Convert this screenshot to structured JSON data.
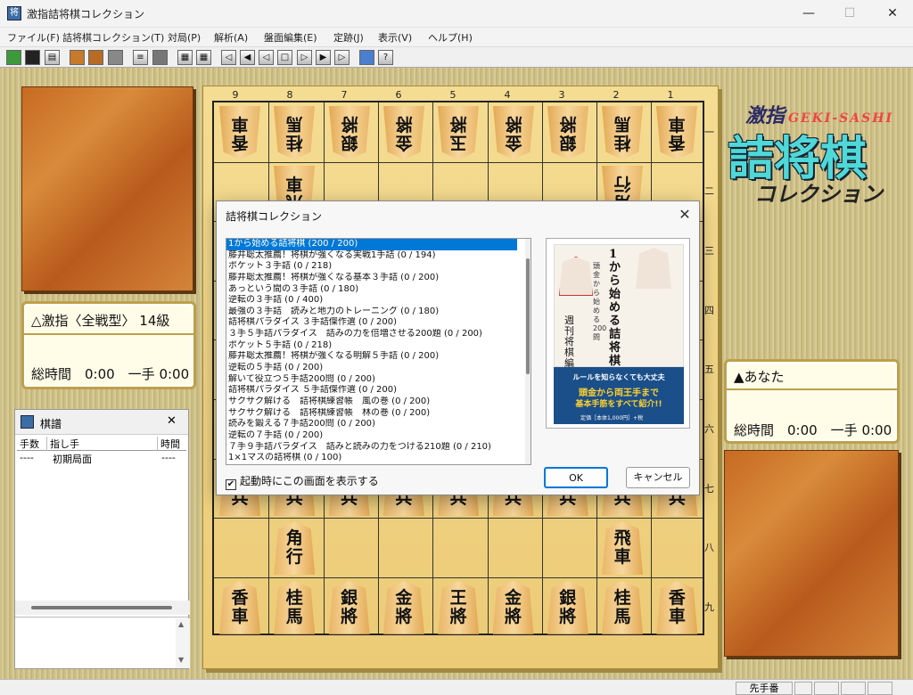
{
  "window": {
    "title": "激指詰将棋コレクション",
    "min": "—",
    "max": "☐",
    "close": "✕",
    "icon": "shogi-app-icon"
  },
  "menu": [
    "ファイル(F)",
    "詰将棋コレクション(T)",
    "対局(P)",
    "解析(A)",
    "盤面編集(E)",
    "定跡(J)",
    "表示(V)",
    "ヘルプ(H)"
  ],
  "toolbar": {
    "icons": [
      "open-icon",
      "save-icon",
      "print-icon",
      "book-icon",
      "book2-icon",
      "blank-icon",
      "list-icon",
      "disk-icon",
      "board-icon",
      "board2-icon",
      "first-icon",
      "back2-icon",
      "back-icon",
      "stop-icon",
      "forward-icon",
      "forward2-icon",
      "last-icon",
      "monitor-icon",
      "help-icon"
    ]
  },
  "board": {
    "files": [
      "9",
      "8",
      "7",
      "6",
      "5",
      "4",
      "3",
      "2",
      "1"
    ],
    "ranks": [
      "一",
      "二",
      "三",
      "四",
      "五",
      "六",
      "七",
      "八",
      "九"
    ]
  },
  "players": {
    "gote": {
      "name": "△激指〈全戦型〉 14級",
      "time": "総時間　0:00　一手 0:00"
    },
    "sente": {
      "name": "▲あなた",
      "time": "総時間　0:00　一手 0:00"
    }
  },
  "logo": {
    "top": "激指",
    "top_roman": "GEKI-SASHI",
    "main": "詰将棋",
    "sub": "コレクション"
  },
  "kifu": {
    "title": "棋譜",
    "close": "✕",
    "headers": [
      "手数",
      "指し手",
      "時間"
    ],
    "rows": [
      [
        "----",
        "初期局面",
        "----"
      ]
    ]
  },
  "dialog": {
    "title": "詰将棋コレクション",
    "close": "✕",
    "items": [
      "1から始める詰将棋 (200 / 200)",
      "藤井聡太推薦！将棋が強くなる実戦1手詰 (0 / 194)",
      "ポケット３手詰 (0 / 218)",
      "藤井聡太推薦！将棋が強くなる基本３手詰 (0 / 200)",
      "あっという間の３手詰 (0 / 180)",
      "逆転の３手詰 (0 / 400)",
      "最強の３手詰　読みと地力のトレーニング (0 / 180)",
      "詰将棋パラダイス ３手詰傑作選 (0 / 200)",
      "３手５手詰パラダイス　詰みの力を倍増させる200題 (0 / 200)",
      "ポケット５手詰 (0 / 218)",
      "藤井聡太推薦！将棋が強くなる明解５手詰 (0 / 200)",
      "逆転の５手詰 (0 / 200)",
      "解いて役立つ５手詰200問 (0 / 200)",
      "詰将棋パラダイス ５手詰傑作選 (0 / 200)",
      "サクサク解ける　詰将棋練習帳　風の巻 (0 / 200)",
      "サクサク解ける　詰将棋練習帳　林の巻 (0 / 200)",
      "読みを鍛える７手詰200問 (0 / 200)",
      "逆転の７手詰 (0 / 200)",
      "７手９手詰パラダイス　詰みと読みの力をつける210題 (0 / 210)",
      "1×1マスの詰将棋 (0 / 100)"
    ],
    "selected_index": 0,
    "cover": {
      "title": "1から始める詰将棋",
      "sub": "頭金から始める200問",
      "publisher": "週刊将棋 編",
      "band1": "ルールを知らなくても大丈夫",
      "band2": "頭金から両王手まで",
      "band3": "基本手筋をすべて紹介!!",
      "price": "定価［本体1,000円］+税",
      "band_color": "#1b4f8a"
    },
    "checkbox_label": "起動時にこの画面を表示する",
    "checkbox_checked": true,
    "ok": "OK",
    "cancel": "キャンセル"
  },
  "status": {
    "turn": "先手番"
  }
}
